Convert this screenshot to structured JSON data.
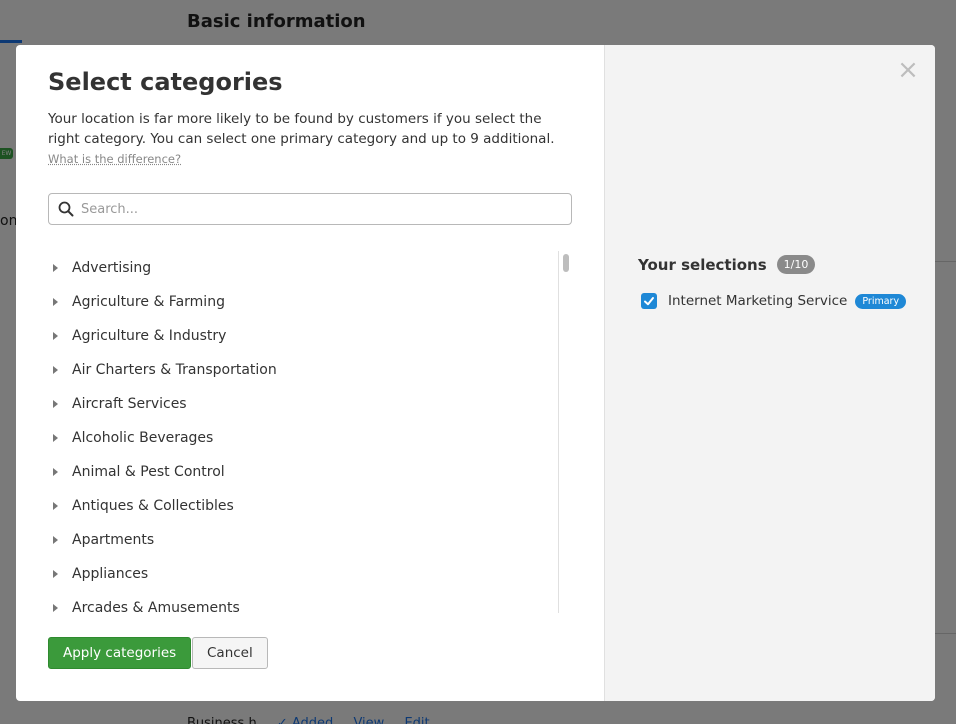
{
  "background": {
    "title": "Basic information",
    "side_text": "on",
    "new_badge": "EW",
    "bottom_items": [
      "Business h",
      "✓ Added",
      "View",
      "Edit"
    ]
  },
  "modal": {
    "title": "Select categories",
    "description": "Your location is far more likely to be found by customers if you select the right category. You can select one primary category and up to 9 additional.",
    "difference_link": "What is the difference?",
    "search": {
      "placeholder": "Search...",
      "value": ""
    },
    "categories": [
      "Advertising",
      "Agriculture & Farming",
      "Agriculture & Industry",
      "Air Charters & Transportation",
      "Aircraft Services",
      "Alcoholic Beverages",
      "Animal & Pest Control",
      "Antiques & Collectibles",
      "Apartments",
      "Appliances",
      "Arcades & Amusements"
    ],
    "apply_label": "Apply categories",
    "cancel_label": "Cancel",
    "close_icon": "×",
    "selections": {
      "title": "Your selections",
      "count": "1/10",
      "items": [
        {
          "label": "Internet Marketing Service",
          "badge": "Primary",
          "checked": true
        }
      ]
    }
  },
  "colors": {
    "apply_green": "#3b9a3b",
    "primary_blue": "#1e88d6",
    "count_gray": "#8a8a8a"
  }
}
